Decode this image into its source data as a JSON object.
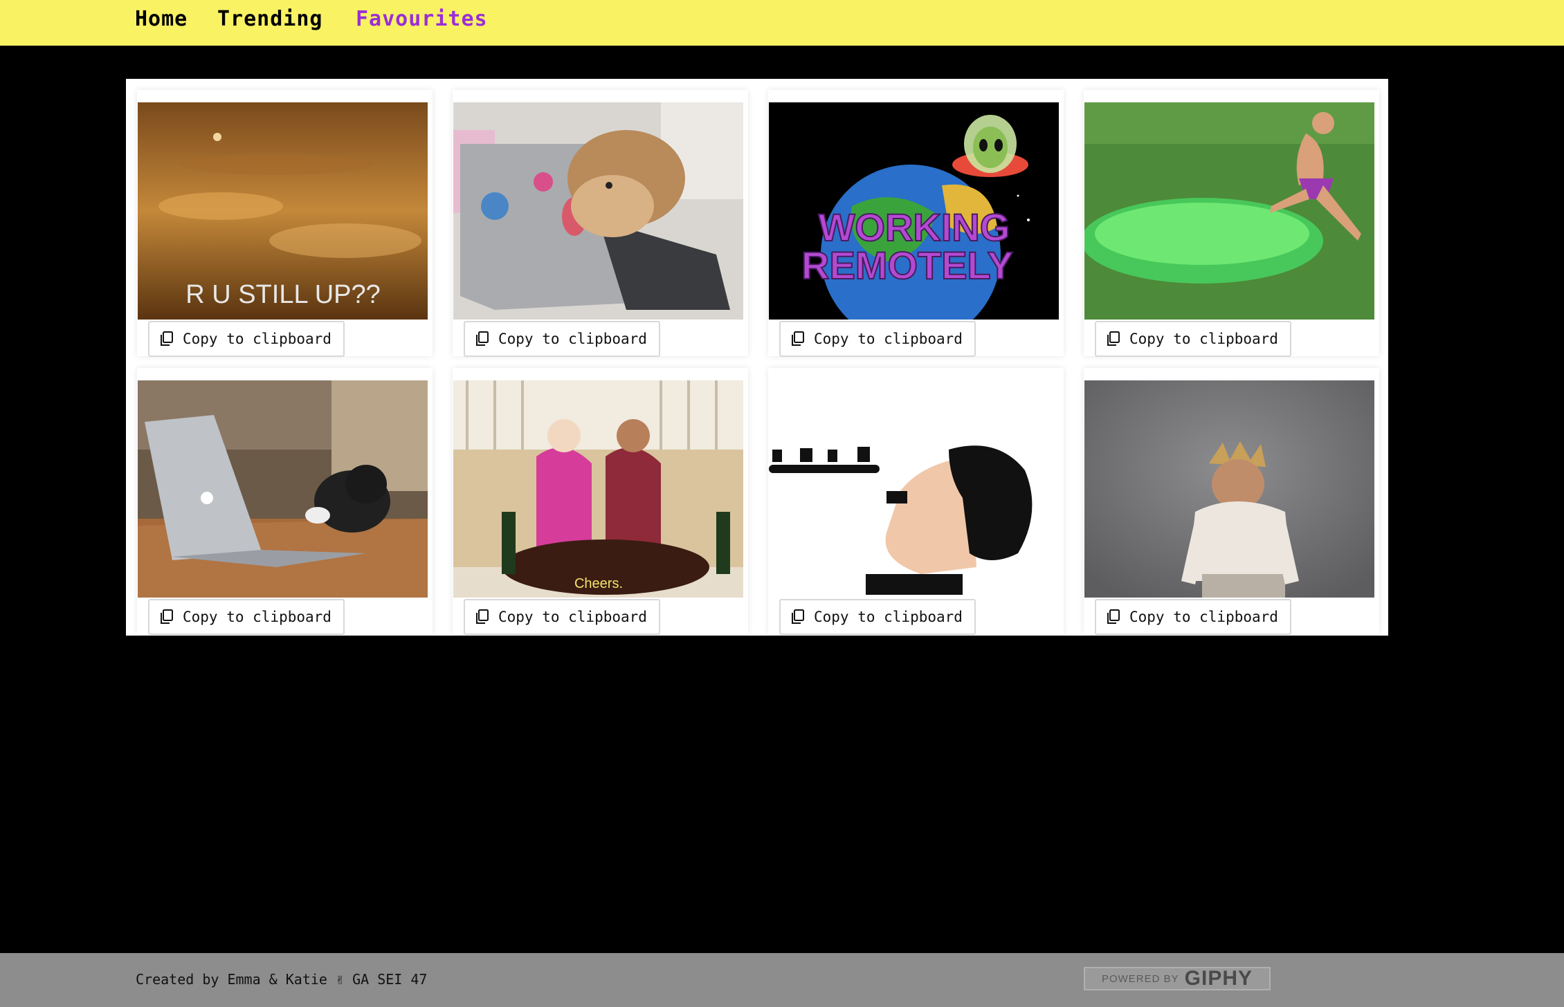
{
  "nav": {
    "home": "Home",
    "trending": "Trending",
    "favourites": "Favourites"
  },
  "cards": [
    {
      "copy_label": "Copy to clipboard",
      "gif_text": "R U STILL UP??"
    },
    {
      "copy_label": "Copy to clipboard"
    },
    {
      "copy_label": "Copy to clipboard",
      "gif_text_line1": "WORKING",
      "gif_text_line2": "REMOTELY"
    },
    {
      "copy_label": "Copy to clipboard"
    },
    {
      "copy_label": "Copy to clipboard"
    },
    {
      "copy_label": "Copy to clipboard",
      "gif_text": "Cheers."
    },
    {
      "copy_label": "Copy to clipboard"
    },
    {
      "copy_label": "Copy to clipboard"
    }
  ],
  "footer": {
    "credit": "Created by Emma & Katie ✌ GA SEI 47",
    "badge_small": "POWERED BY",
    "badge_big": "GIPHY"
  },
  "icons": {
    "copy": "clipboard-icon"
  },
  "colors": {
    "navbar": "#f9f263",
    "active_link": "#9a2fd6",
    "background": "#000000",
    "footer": "#8d8d8d"
  }
}
